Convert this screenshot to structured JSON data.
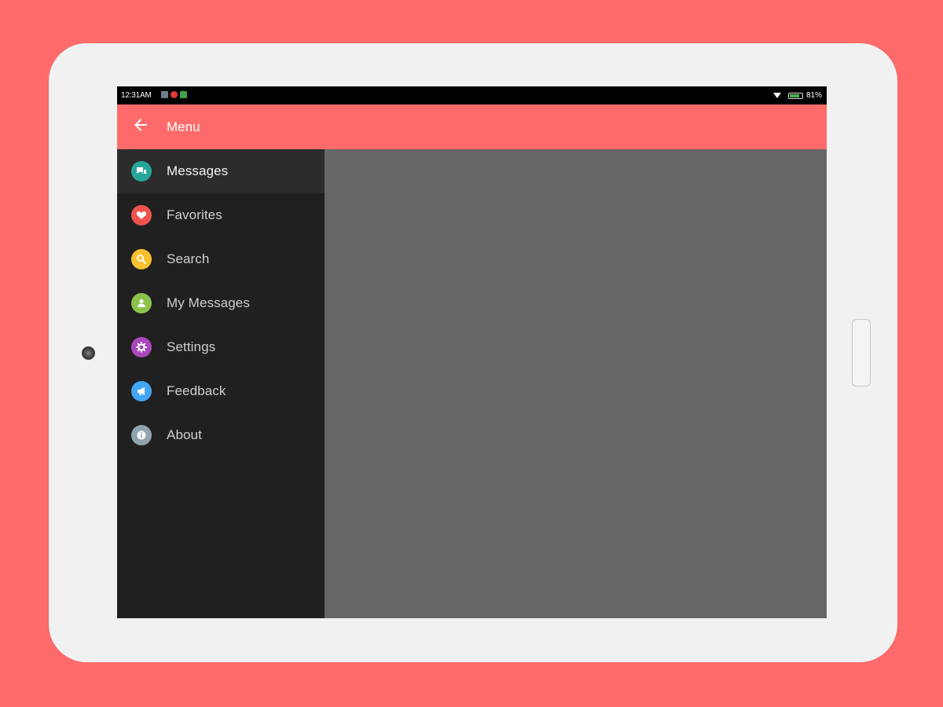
{
  "status_bar": {
    "time": "12:31AM",
    "battery_text": "81%",
    "battery_level": 0.81,
    "notification_colors": [
      "#6e7b8c",
      "#e53935",
      "#43a047"
    ]
  },
  "app_bar": {
    "title": "Menu",
    "back_icon": "arrow-left-icon",
    "color": "#ff6b6b"
  },
  "drawer": {
    "items": [
      {
        "label": "Messages",
        "icon": "chat-icon",
        "color": "#26a69a",
        "active": true
      },
      {
        "label": "Favorites",
        "icon": "heart-icon",
        "color": "#ef5350",
        "active": false
      },
      {
        "label": "Search",
        "icon": "search-icon",
        "color": "#fbc02d",
        "active": false
      },
      {
        "label": "My Messages",
        "icon": "person-icon",
        "color": "#8bc34a",
        "active": false
      },
      {
        "label": "Settings",
        "icon": "gear-icon",
        "color": "#ab47bc",
        "active": false
      },
      {
        "label": "Feedback",
        "icon": "megaphone-icon",
        "color": "#42a5f5",
        "active": false
      },
      {
        "label": "About",
        "icon": "info-icon",
        "color": "#90a4ae",
        "active": false
      }
    ]
  },
  "colors": {
    "background": "#ff6b6b",
    "drawer": "#202020",
    "content": "#666666"
  }
}
